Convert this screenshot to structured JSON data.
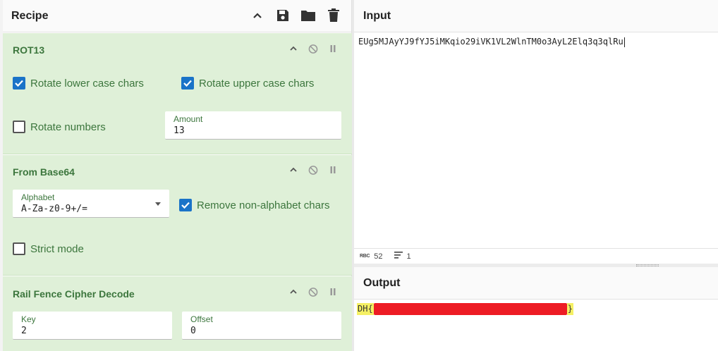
{
  "recipe": {
    "title": "Recipe",
    "actions": [
      "chevron-up-icon",
      "save-icon",
      "folder-icon",
      "trash-icon"
    ]
  },
  "operations": [
    {
      "title": "ROT13",
      "checkboxes": [
        {
          "label": "Rotate lower case chars",
          "checked": true
        },
        {
          "label": "Rotate upper case chars",
          "checked": true
        },
        {
          "label": "Rotate numbers",
          "checked": false
        }
      ],
      "fields": [
        {
          "label": "Amount",
          "value": "13"
        }
      ]
    },
    {
      "title": "From Base64",
      "dropdowns": [
        {
          "label": "Alphabet",
          "value": "A-Za-z0-9+/="
        }
      ],
      "checkboxes": [
        {
          "label": "Remove non-alphabet chars",
          "checked": true
        },
        {
          "label": "Strict mode",
          "checked": false
        }
      ]
    },
    {
      "title": "Rail Fence Cipher Decode",
      "fields": [
        {
          "label": "Key",
          "value": "2"
        },
        {
          "label": "Offset",
          "value": "0"
        }
      ]
    }
  ],
  "input": {
    "title": "Input",
    "value": "EUg5MJAyYJ9fYJ5iMKqio29iVK1VL2WlnTM0o3AyL2Elq3q3qlRu",
    "stats": {
      "chars_icon": "abc-icon",
      "chars": "52",
      "lines_icon": "lines-icon",
      "lines": "1"
    }
  },
  "output": {
    "title": "Output",
    "prefix": "DH{",
    "suffix": "}"
  },
  "colors": {
    "op_bg": "#dff0d8",
    "op_text": "#3c763d",
    "checkbox_on": "#1a73c8",
    "highlight": "#f5f064",
    "redaction": "#ed1c24"
  }
}
